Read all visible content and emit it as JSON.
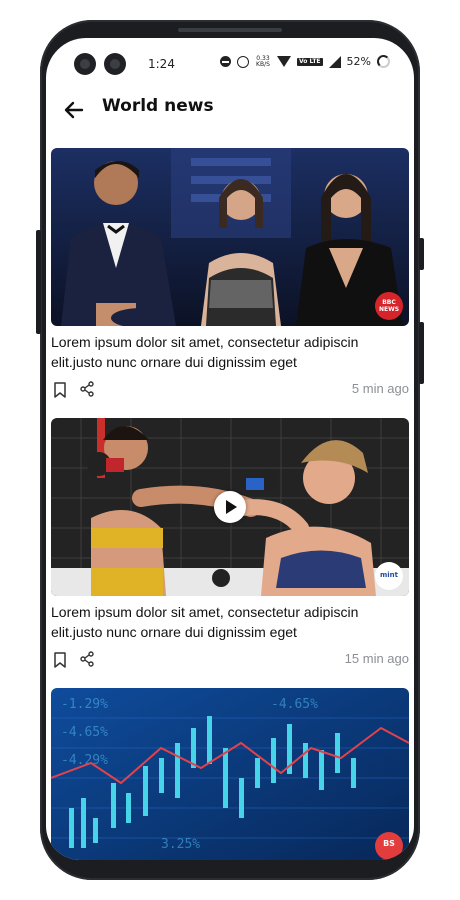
{
  "status_bar": {
    "time": "1:24",
    "net_speed": "0.33",
    "net_unit": "KB/S",
    "volte": "Vo LTE",
    "battery": "52%"
  },
  "app_bar": {
    "title": "World news",
    "back_icon": "arrow-left-icon"
  },
  "articles": [
    {
      "headline": "Lorem ipsum dolor sit amet, consectetur adipiscin elit.justo nunc ornare dui dignissim eget",
      "time_ago": "5 min ago",
      "source_badge": "BBC NEWS",
      "has_video": false
    },
    {
      "headline": "Lorem ipsum dolor sit amet, consectetur adipiscin elit.justo nunc ornare dui dignissim eget",
      "time_ago": "15 min ago",
      "source_badge": "mint",
      "has_video": true
    },
    {
      "headline": "",
      "time_ago": "",
      "source_badge": "BS",
      "has_video": false
    }
  ],
  "icons": {
    "bookmark": "bookmark-icon",
    "share": "share-icon",
    "play": "play-icon"
  },
  "colors": {
    "background": "#ffffff",
    "text": "#111111",
    "muted": "#8b8f94",
    "frame": "#1b1d20"
  }
}
